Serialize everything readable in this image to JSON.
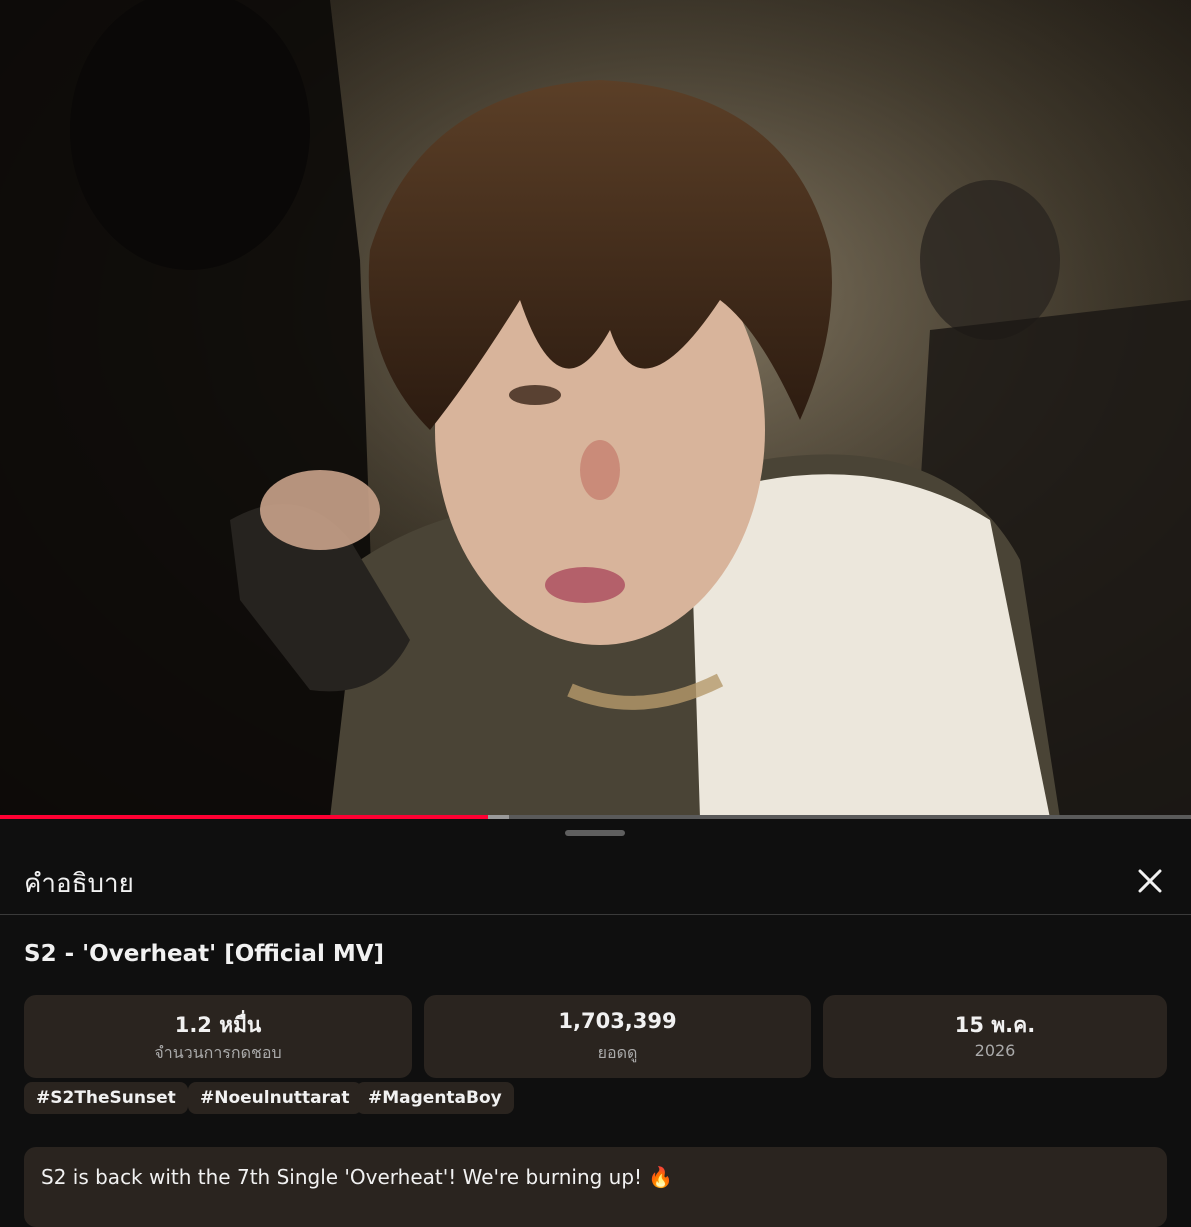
{
  "player": {
    "progress_fraction": 0.41,
    "buffer_fraction": 0.427
  },
  "sheet": {
    "title": "คำอธิบาย",
    "close_label": "×"
  },
  "video": {
    "title": "S2 - 'Overheat' [Official MV]"
  },
  "stats": [
    {
      "value": "1.2 หมื่น",
      "label": "จำนวนการกดชอบ"
    },
    {
      "value": "1,703,399",
      "label": "ยอดดู"
    },
    {
      "value": "15 พ.ค.",
      "label": "2026"
    }
  ],
  "hashtags": [
    "#S2TheSunset",
    "#Noeulnuttarat",
    "#MagentaBoy"
  ],
  "description": {
    "text": "S2 is back with the 7th Single 'Overheat'! We're burning up! 🔥"
  },
  "colors": {
    "accent_red": "#ff0033",
    "card_bg": "#2a241f",
    "sheet_bg": "#0f0f0f"
  }
}
